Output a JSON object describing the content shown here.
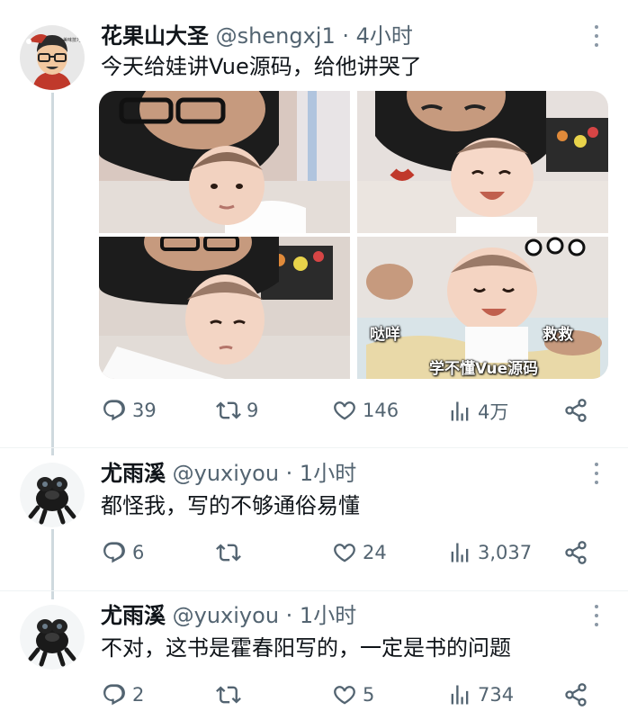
{
  "colors": {
    "text": "#0f1419",
    "secondary": "#536471",
    "icon": "#536471",
    "thread_line": "#cfd9de"
  },
  "icons": [
    "reply-icon",
    "retweet-icon",
    "like-icon",
    "views-icon",
    "share-icon",
    "more-icon"
  ],
  "tweets": [
    {
      "name": "花果山大圣",
      "handle": "@shengxj1",
      "time": "· 4小时",
      "text": "今天给娃讲Vue源码，给他讲哭了",
      "avatar_text": "美味技巧",
      "stickers": {
        "s1": "哒咩",
        "s2": "救救",
        "s3": "学不懂Vue源码"
      },
      "replies": "39",
      "retweets": "9",
      "likes": "146",
      "views": "4万"
    },
    {
      "name": "尤雨溪",
      "handle": "@yuxiyou",
      "time": "· 1小时",
      "text": "都怪我，写的不够通俗易懂",
      "replies": "6",
      "retweets": "",
      "likes": "24",
      "views": "3,037"
    },
    {
      "name": "尤雨溪",
      "handle": "@yuxiyou",
      "time": "· 1小时",
      "text": "不对，这书是霍春阳写的，一定是书的问题",
      "replies": "2",
      "retweets": "",
      "likes": "5",
      "views": "734"
    }
  ]
}
